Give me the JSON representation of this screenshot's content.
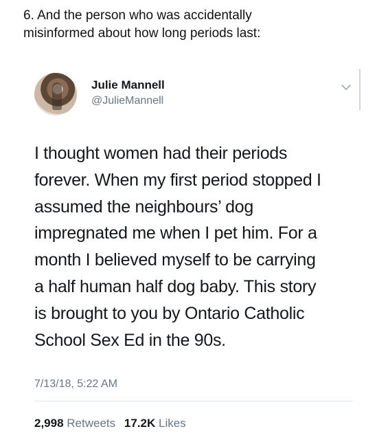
{
  "caption": {
    "line1": "6. And the person who was accidentally",
    "line2": "misinformed about how long periods last:"
  },
  "tweet": {
    "author": {
      "display_name": "Julie Mannell",
      "handle": "@JulieMannell"
    },
    "caret_icon": "chevron-down-icon",
    "text_lines": [
      "I thought women had their periods",
      "forever. When my first period stopped I",
      "assumed the neighbours’ dog",
      "impregnated me when I pet him. For a",
      "month I believed myself to be carrying",
      "a half human half dog baby. This story",
      "is brought to you by Ontario Catholic",
      "School Sex Ed in the 90s."
    ],
    "timestamp": "7/13/18, 5:22 AM",
    "stats": {
      "retweets_count": "2,998",
      "retweets_label": "Retweets",
      "likes_count": "17.2K",
      "likes_label": "Likes"
    }
  },
  "colors": {
    "text_primary": "#14171a",
    "text_secondary": "#657786",
    "divider": "#e1e8ed"
  }
}
